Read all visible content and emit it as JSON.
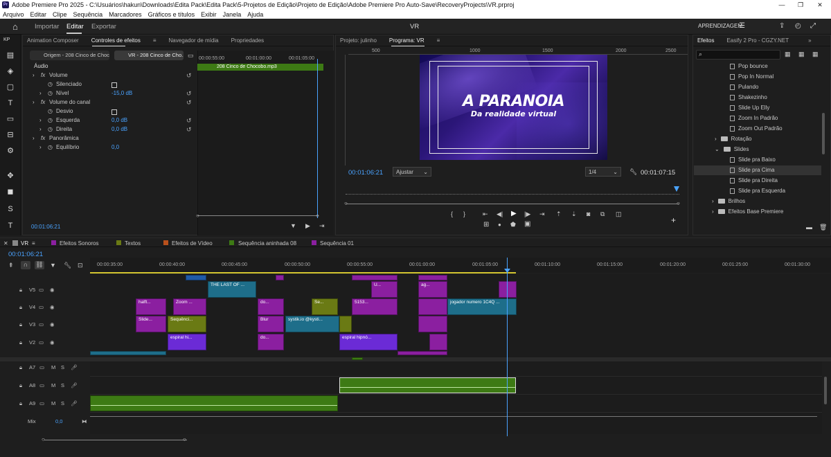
{
  "titlebar": {
    "title": "Adobe Premiere Pro 2025 - C:\\Usuários\\hakun\\Downloads\\Edita Pack\\Edita Pack\\5-Projetos de Edição\\Projeto de Edição\\Adobe Premiere Pro Auto-Save\\RecoveryProjects\\VR.prproj",
    "app_icon": "Pr",
    "minimize": "—",
    "maximize": "❐",
    "close": "✕"
  },
  "menu": [
    "Arquivo",
    "Editar",
    "Clipe",
    "Sequência",
    "Marcadores",
    "Gráficos e títulos",
    "Exibir",
    "Janela",
    "Ajuda"
  ],
  "workspace": {
    "tabs": [
      "Importar",
      "Editar",
      "Exportar"
    ],
    "active_tab": "Editar",
    "center_title": "VR",
    "learning": "APRENDIZAGEM"
  },
  "effect_controls": {
    "tabs": [
      "Animation Composer",
      "Controles de efeitos",
      "Navegador de mídia",
      "Propriedades"
    ],
    "kp": "KP",
    "source_tab": "Origem - 208 Cinco de Choco...",
    "seq_tab": "VR - 208 Cinco de Cho...",
    "section": "Áudio",
    "clip_name": "208 Cinco de Chocobo.mp3",
    "ruler": [
      "00:00:55:00",
      "00:01:00:00",
      "00:01:05:00"
    ],
    "rows": [
      {
        "label": "Volume",
        "type": "fx"
      },
      {
        "label": "Silenciado",
        "type": "checkbox"
      },
      {
        "label": "Nível",
        "value": "-15,0 dB"
      },
      {
        "label": "Volume do canal",
        "type": "fx"
      },
      {
        "label": "Desvio",
        "type": "checkbox"
      },
      {
        "label": "Esquerda",
        "value": "0,0 dB"
      },
      {
        "label": "Direita",
        "value": "0,0 dB"
      },
      {
        "label": "Panorâmica",
        "type": "fx"
      },
      {
        "label": "Equilíbrio",
        "value": "0,0"
      }
    ],
    "timecode": "00:01:06:21"
  },
  "program": {
    "tabs": [
      "Projeto: julinho",
      "Programa: VR"
    ],
    "ruler": [
      "500",
      "1000",
      "1500",
      "2000",
      "2500"
    ],
    "video_title": "A PARANOIA",
    "video_subtitle": "Da realidade virtual",
    "timecode_left": "00:01:06:21",
    "fit": "Ajustar",
    "resolution": "1/4",
    "timecode_right": "00:01:07:15"
  },
  "effects": {
    "tabs": [
      "Efeitos",
      "Easify 2 Pro - CGZY.NET"
    ],
    "items": [
      {
        "label": "Pop bounce",
        "kind": "preset"
      },
      {
        "label": "Pop In Normal",
        "kind": "preset"
      },
      {
        "label": "Pulando",
        "kind": "preset"
      },
      {
        "label": "Shakezinho",
        "kind": "preset"
      },
      {
        "label": "Slide Up Elly",
        "kind": "preset"
      },
      {
        "label": "Zoom In Padrão",
        "kind": "preset"
      },
      {
        "label": "Zoom Out Padrão",
        "kind": "preset"
      },
      {
        "label": "Rotação",
        "kind": "folder"
      },
      {
        "label": "Slides",
        "kind": "folder-open"
      },
      {
        "label": "Slide pra Baixo",
        "kind": "preset"
      },
      {
        "label": "Slide pra Cima",
        "kind": "preset"
      },
      {
        "label": "Slide pra Direita",
        "kind": "preset"
      },
      {
        "label": "Slide pra Esquerda",
        "kind": "preset"
      },
      {
        "label": "Brilhos",
        "kind": "folder"
      },
      {
        "label": "Efeitos Base Premiere",
        "kind": "folder"
      }
    ]
  },
  "timeline": {
    "tabs": [
      {
        "label": "VR",
        "color": "#888888"
      },
      {
        "label": "Efeitos Sonoros",
        "color": "#8b1fa0"
      },
      {
        "label": "Textos",
        "color": "#6a7a14"
      },
      {
        "label": "Efeitos de Vídeo",
        "color": "#b8501c"
      },
      {
        "label": "Sequência aninhada 08",
        "color": "#3d7a14"
      },
      {
        "label": "Sequência 01",
        "color": "#8b1fa0"
      }
    ],
    "timecode": "00:01:06:21",
    "ruler": [
      "00:00:35:00",
      "00:00:40:00",
      "00:00:45:00",
      "00:00:50:00",
      "00:00:55:00",
      "00:01:00:00",
      "00:01:05:00",
      "00:01:10:00",
      "00:01:15:00",
      "00:01:20:00",
      "00:01:25:00",
      "00:01:30:00"
    ],
    "video_tracks": [
      "V5",
      "V4",
      "V3",
      "V2"
    ],
    "audio_tracks": [
      "A7",
      "A8",
      "A9"
    ],
    "mix_label": "Mix",
    "mix_value": "0,0",
    "clips": [
      {
        "label": "THE LAST OF ...",
        "color": "teal"
      },
      {
        "label": "U...",
        "color": "purple"
      },
      {
        "label": "ag...",
        "color": "purple"
      },
      {
        "label": "halft...",
        "color": "purple"
      },
      {
        "label": "Zoom ...",
        "color": "purple"
      },
      {
        "label": "do...",
        "color": "purple"
      },
      {
        "label": "Se...",
        "color": "olive"
      },
      {
        "label": "5153...",
        "color": "purple"
      },
      {
        "label": "jogador numero 1C4Q ...",
        "color": "teal"
      },
      {
        "label": "Slide...",
        "color": "purple"
      },
      {
        "label": "Sequênci...",
        "color": "olive"
      },
      {
        "label": "Blur",
        "color": "purple"
      },
      {
        "label": "systik.io  @kysti...",
        "color": "teal"
      },
      {
        "label": "espiral hi...",
        "color": "violet"
      },
      {
        "label": "do...",
        "color": "purple"
      },
      {
        "label": "espiral hipnó...",
        "color": "violet"
      }
    ]
  }
}
